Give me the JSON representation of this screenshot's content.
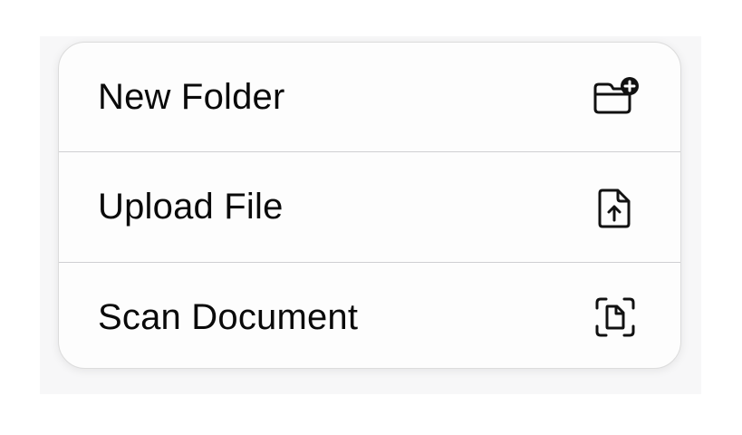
{
  "menu": {
    "items": [
      {
        "label": "New Folder",
        "icon": "folder-plus-icon"
      },
      {
        "label": "Upload File",
        "icon": "file-upload-icon"
      },
      {
        "label": "Scan Document",
        "icon": "document-scan-icon"
      }
    ]
  },
  "colors": {
    "text": "#0a0a0a",
    "menu_background": "#fdfdfd",
    "divider": "#cfcfd2",
    "icon_stroke": "#111111"
  }
}
